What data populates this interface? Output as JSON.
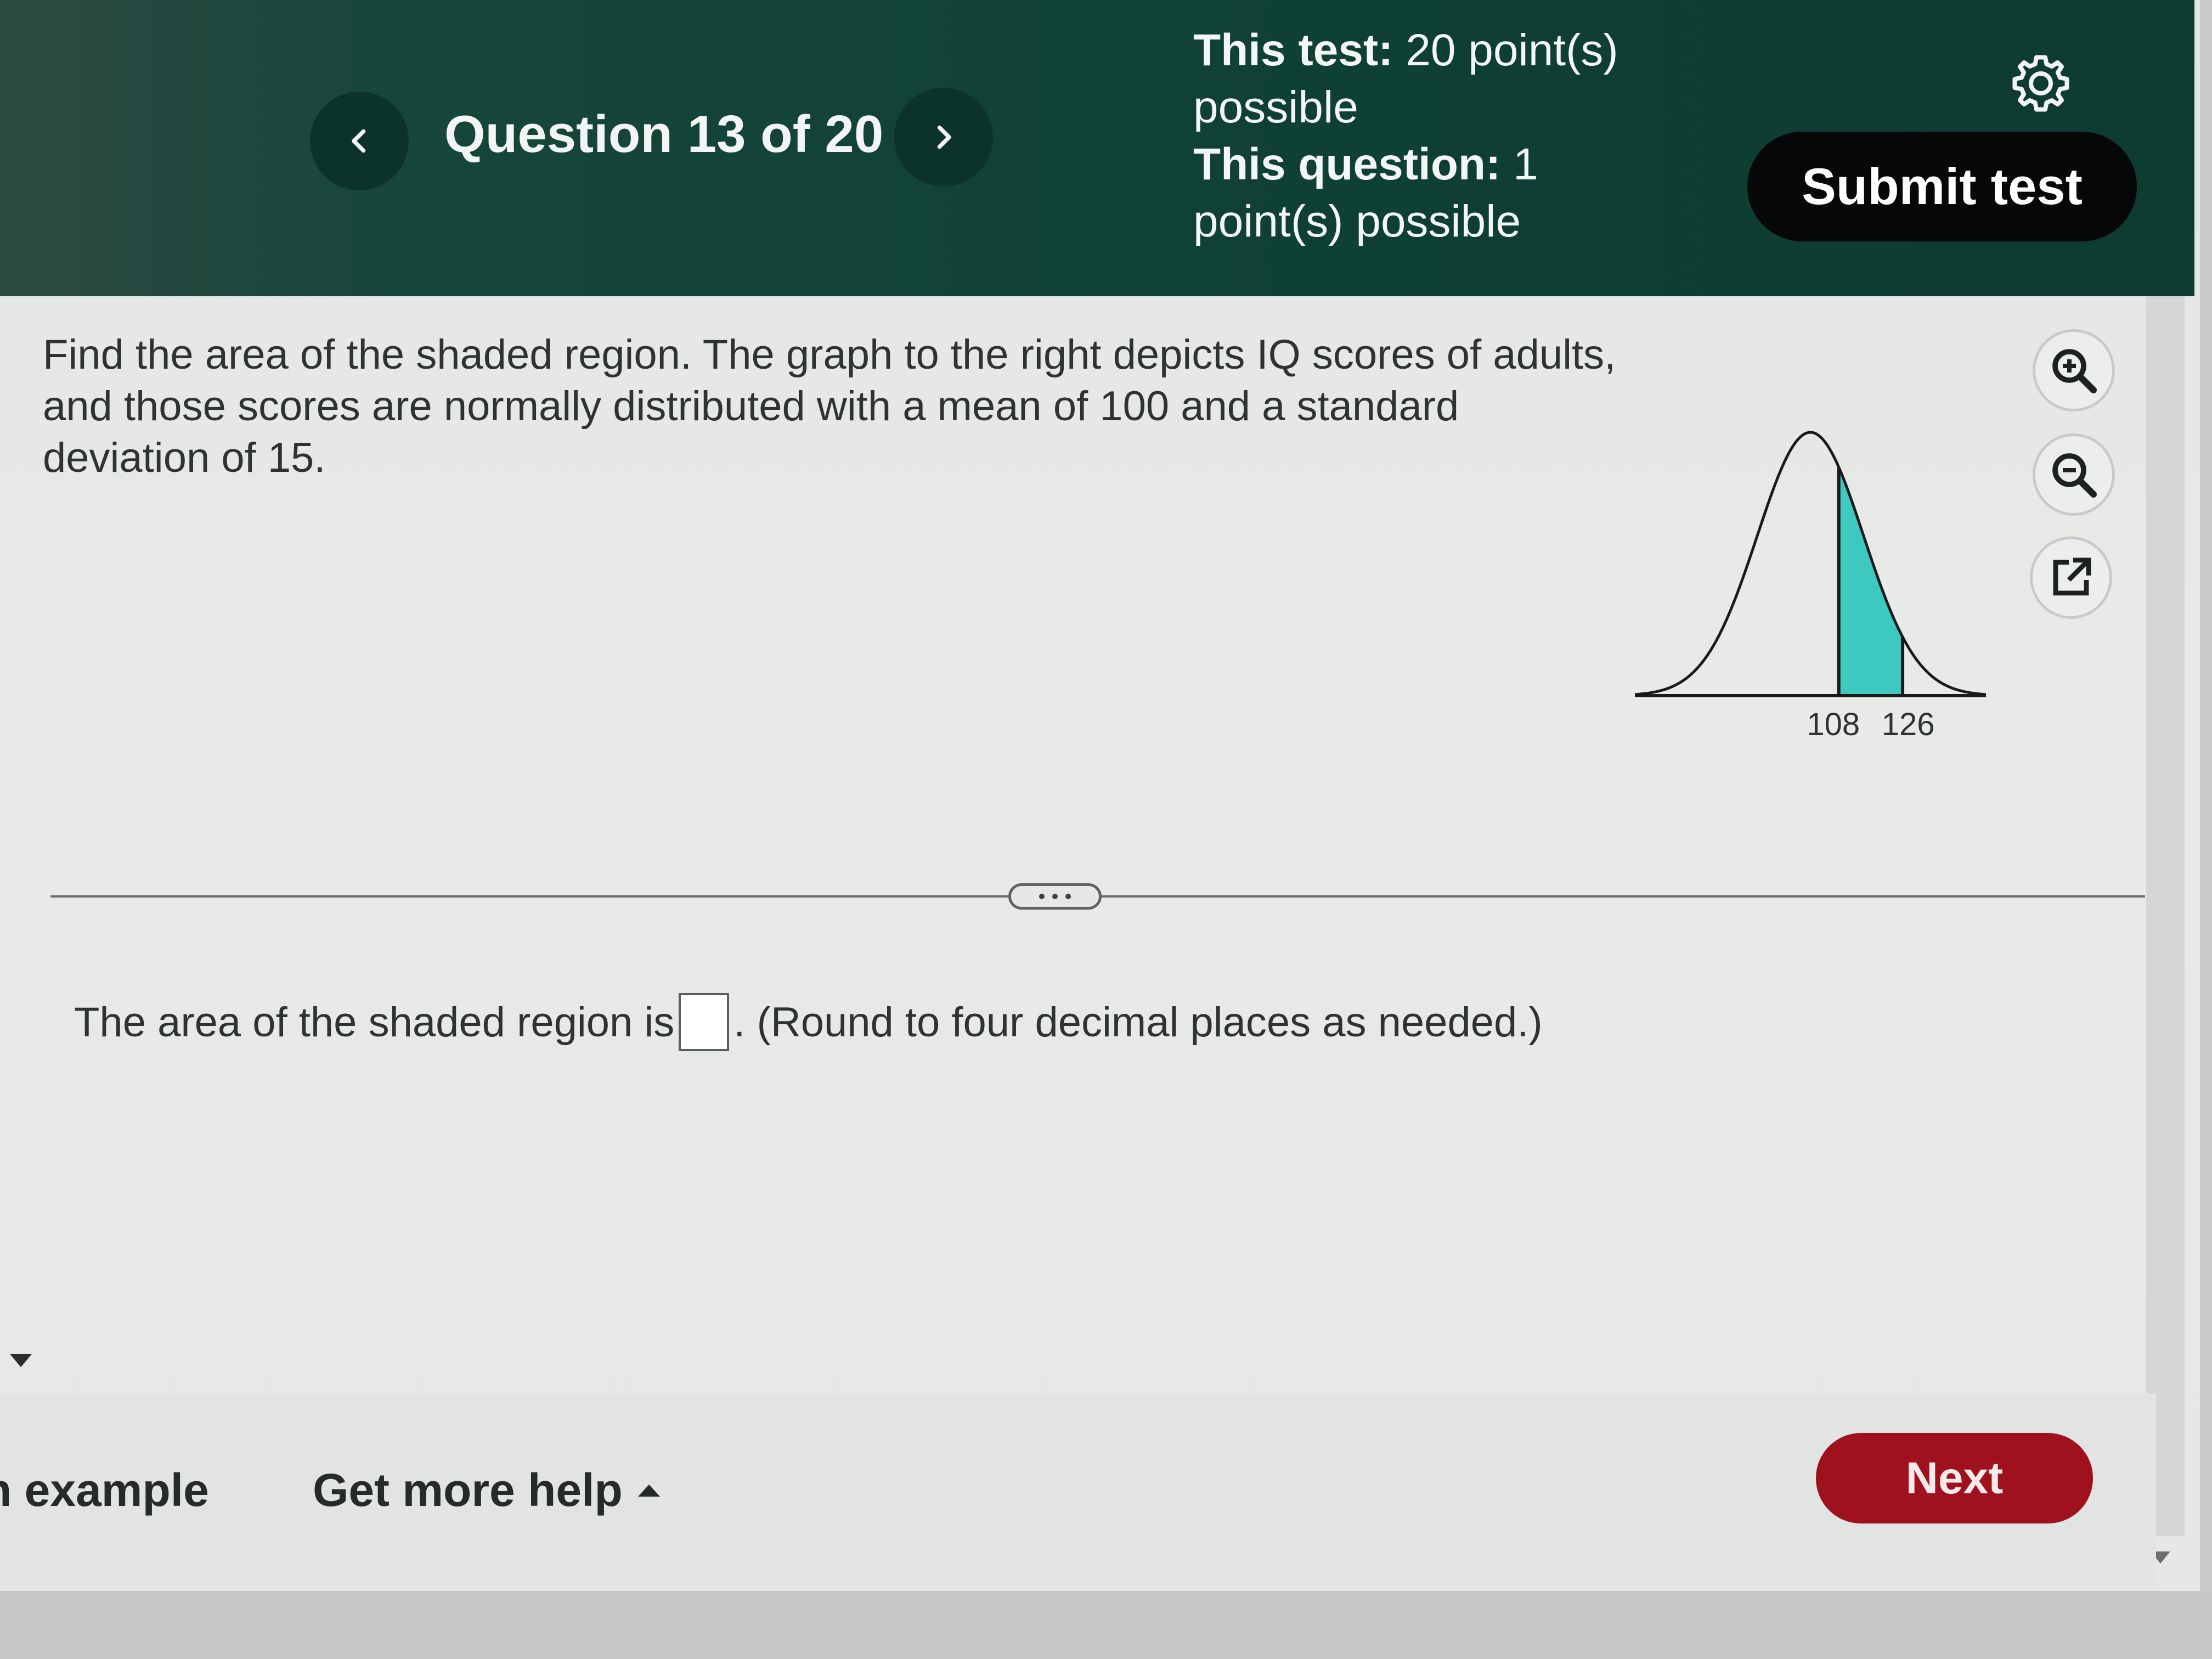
{
  "header": {
    "question_title": "Question 13 of 20",
    "test_points_label": "This test:",
    "test_points_value": "20 point(s) possible",
    "question_points_label": "This question:",
    "question_points_value": "1 point(s) possible",
    "submit_label": "Submit test"
  },
  "question": {
    "text": "Find the area of the shaded region. The graph to the right depicts IQ scores of adults, and those scores are normally distributed with a mean of 100 and a standard deviation of 15.",
    "graph": {
      "tick_labels": [
        "108",
        "126"
      ],
      "shaded_color": "#3ec9c0"
    }
  },
  "answer": {
    "prefix": "The area of the shaded region is",
    "input_value": "",
    "suffix": ". (Round to four decimal places as needed.)"
  },
  "footer": {
    "similar_example_label": "n example",
    "get_more_help_label": "Get more help",
    "next_label": "Next"
  },
  "colors": {
    "header_bg": "#0f4035",
    "next_button": "#a0111e",
    "submit_button": "#050807"
  },
  "icons": [
    "chevron-left-icon",
    "chevron-right-icon",
    "gear-icon",
    "zoom-in-icon",
    "zoom-out-icon",
    "popout-icon",
    "caret-up-icon"
  ]
}
